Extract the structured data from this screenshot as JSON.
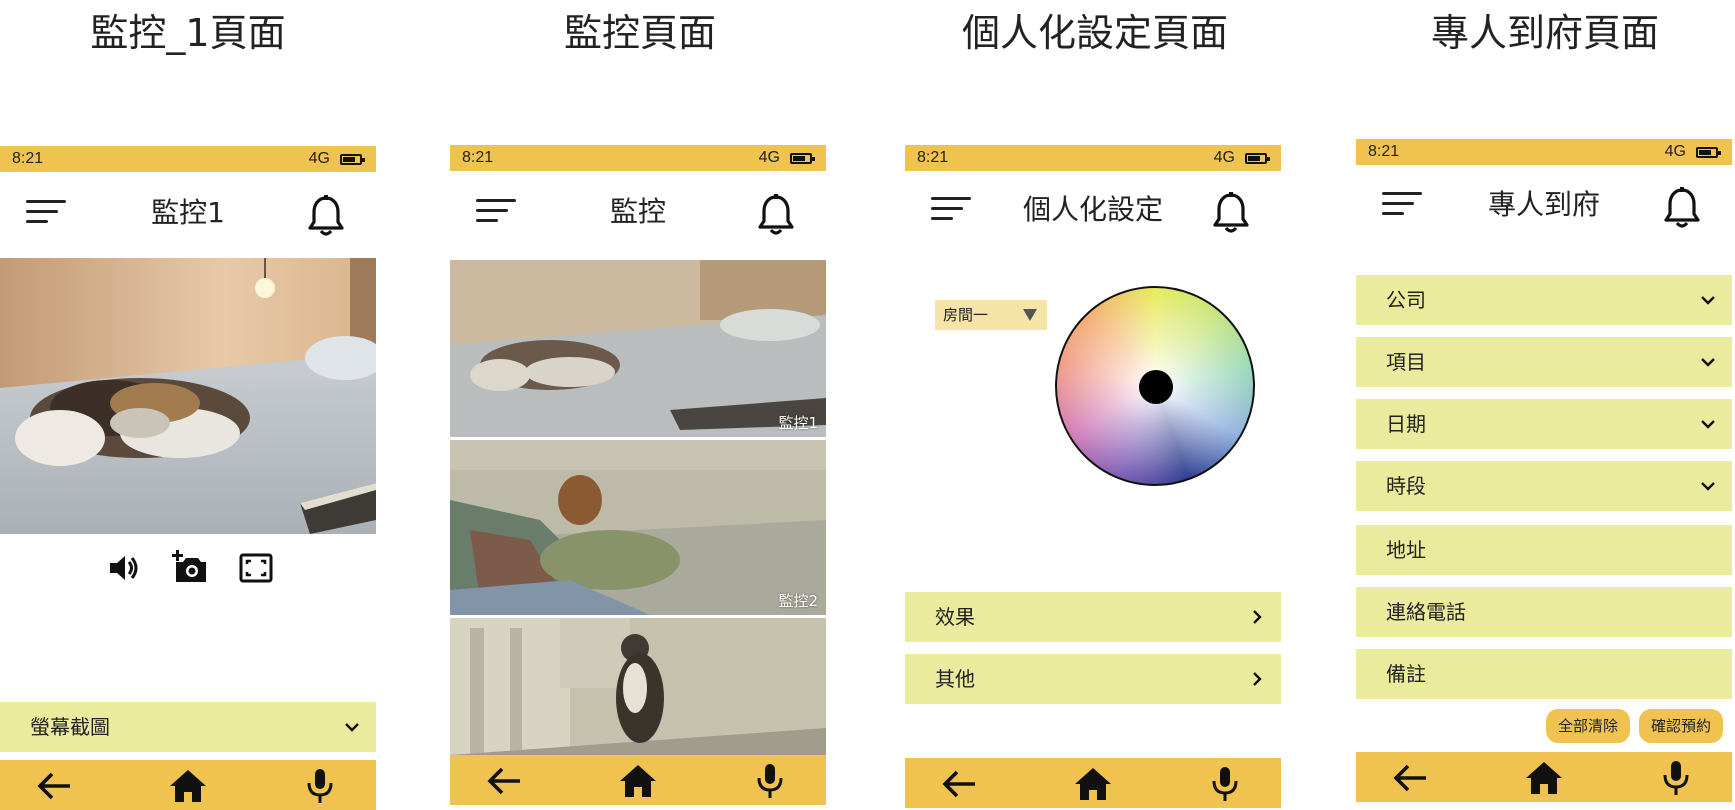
{
  "panels": [
    {
      "title": "監控_1頁面"
    },
    {
      "title": "監控頁面"
    },
    {
      "title": "個人化設定頁面"
    },
    {
      "title": "專人到府頁面"
    }
  ],
  "status_bar": {
    "time": "8:21",
    "network": "4G"
  },
  "colors": {
    "accent": "#f0c350",
    "row": "#eaeb9d",
    "dropdown": "#f6e3a7"
  },
  "screen1": {
    "appbar_title": "監控1",
    "controls": [
      "volume-icon",
      "add-photo-icon",
      "fullscreen-icon"
    ],
    "screenshot_row": "螢幕截圖"
  },
  "screen2": {
    "appbar_title": "監控",
    "cameras": [
      {
        "label": "監控1"
      },
      {
        "label": "監控2"
      },
      {
        "label": ""
      }
    ]
  },
  "screen3": {
    "appbar_title": "個人化設定",
    "room_select": "房間一",
    "rows": [
      "效果",
      "其他"
    ]
  },
  "screen4": {
    "appbar_title": "專人到府",
    "fields": [
      {
        "label": "公司",
        "type": "dropdown"
      },
      {
        "label": "項目",
        "type": "dropdown"
      },
      {
        "label": "日期",
        "type": "dropdown"
      },
      {
        "label": "時段",
        "type": "dropdown"
      },
      {
        "label": "地址",
        "type": "text"
      },
      {
        "label": "連絡電話",
        "type": "text"
      },
      {
        "label": "備註",
        "type": "text"
      }
    ],
    "clear_button": "全部清除",
    "confirm_button": "確認預約"
  },
  "bottom_nav": [
    "back-arrow-icon",
    "home-icon",
    "microphone-icon"
  ]
}
